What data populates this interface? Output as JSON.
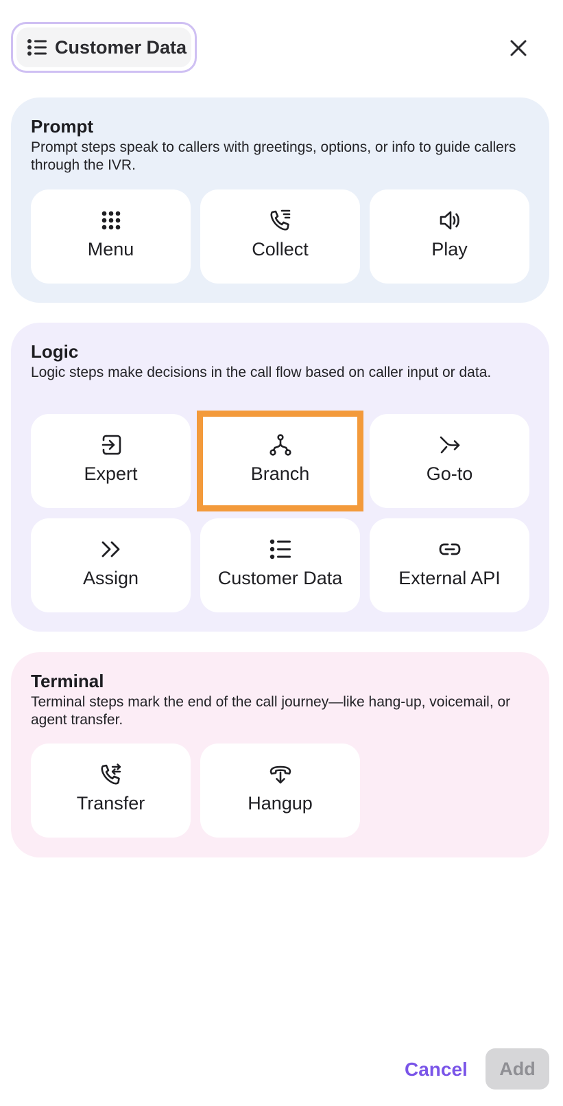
{
  "header": {
    "selected_step_label": "Customer Data",
    "selected_step_icon": "list-icon",
    "close_icon": "close-icon"
  },
  "sections": {
    "prompt": {
      "title": "Prompt",
      "description": "Prompt steps speak to callers with greetings, options, or info to guide callers through the IVR.",
      "background": "#eaf0f9",
      "tiles": {
        "menu": {
          "label": "Menu",
          "icon": "keypad-icon"
        },
        "collect": {
          "label": "Collect",
          "icon": "phone-collect-icon"
        },
        "play": {
          "label": "Play",
          "icon": "speaker-icon"
        }
      }
    },
    "logic": {
      "title": "Logic",
      "description": "Logic steps make decisions in the call flow based on caller input or data.",
      "background": "#f1eefc",
      "tiles": {
        "expert": {
          "label": "Expert",
          "icon": "enter-box-icon"
        },
        "branch": {
          "label": "Branch",
          "icon": "branch-icon",
          "selected": true
        },
        "goto": {
          "label": "Go-to",
          "icon": "goto-arrow-icon"
        },
        "assign": {
          "label": "Assign",
          "icon": "double-chevron-icon"
        },
        "customer_data": {
          "label": "Customer Data",
          "icon": "list-icon"
        },
        "external_api": {
          "label": "External API",
          "icon": "link-icon"
        }
      }
    },
    "terminal": {
      "title": "Terminal",
      "description": "Terminal steps mark the end of the call journey—like hang-up, voicemail, or agent transfer.",
      "background": "#fcedf6",
      "tiles": {
        "transfer": {
          "label": "Transfer",
          "icon": "phone-transfer-icon"
        },
        "hangup": {
          "label": "Hangup",
          "icon": "hangup-icon"
        }
      }
    }
  },
  "footer": {
    "cancel_label": "Cancel",
    "add_label": "Add",
    "add_disabled": true
  },
  "colors": {
    "accent": "#7a55e8",
    "selection_outline": "#f39a3b",
    "chip_border": "#cfc0f3",
    "disabled_button": "#d6d6d8"
  }
}
